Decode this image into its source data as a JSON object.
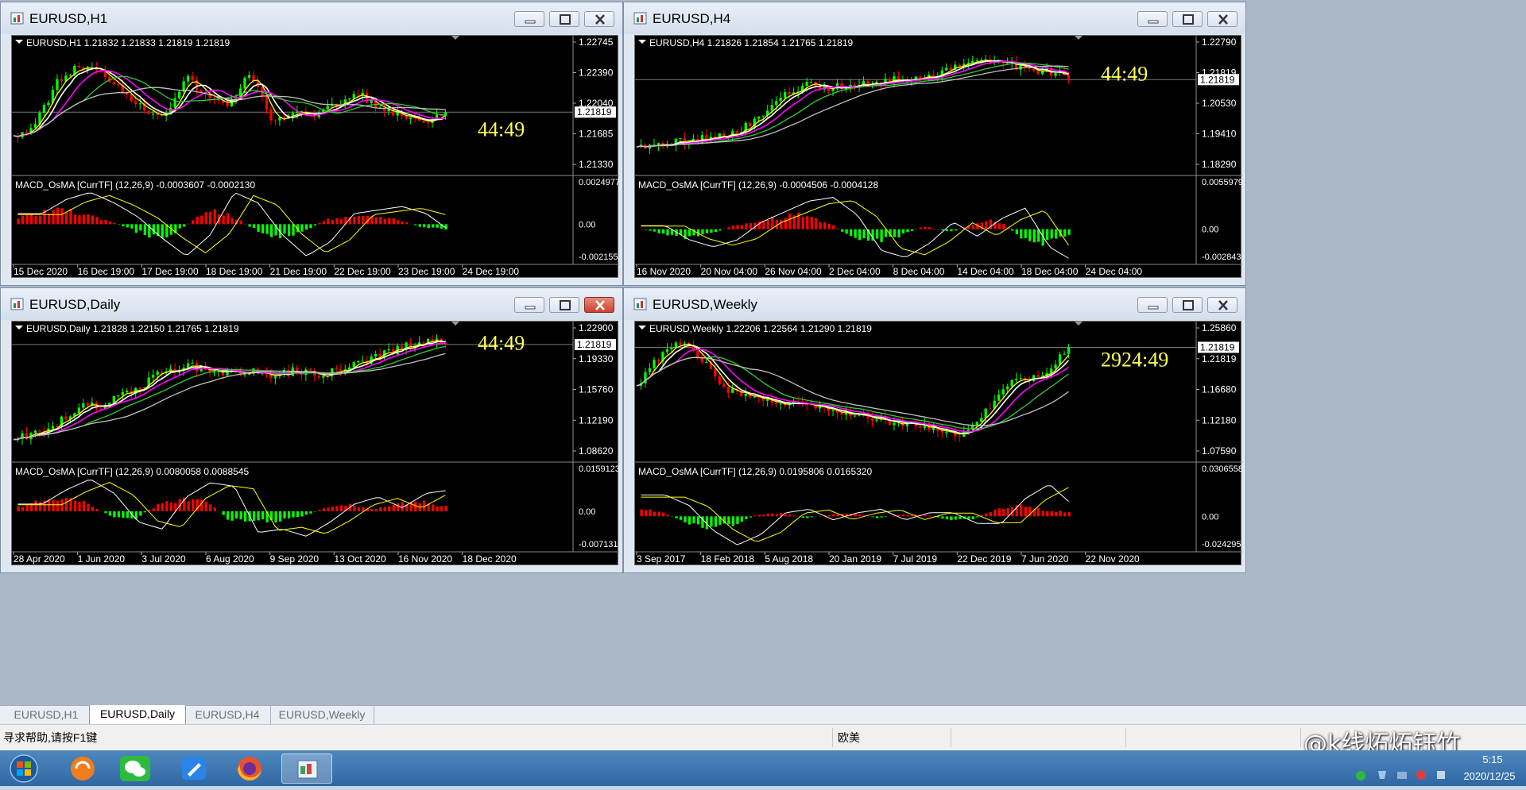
{
  "windows": [
    {
      "id": "h1",
      "title": "EURUSD,H1",
      "close_active": false,
      "info": "EURUSD,H1  1.21832 1.21833 1.21819 1.21819",
      "price_scale": [
        "1.22745",
        "1.22390",
        "1.22040",
        "1.21685",
        "1.21330"
      ],
      "current_price": "1.21819",
      "countdown": "44:49",
      "macd_info": "MACD_OsMA [CurrTF] (12,26,9) -0.0003607 -0.0002130",
      "macd_scale": [
        "0.0024977",
        "0.00",
        "-0.0021552"
      ],
      "dates": [
        "15 Dec 2020",
        "16 Dec 19:00",
        "17 Dec 19:00",
        "18 Dec 19:00",
        "21 Dec 19:00",
        "22 Dec 19:00",
        "23 Dec 19:00",
        "24 Dec 19:00"
      ]
    },
    {
      "id": "h4",
      "title": "EURUSD,H4",
      "close_active": false,
      "info": "EURUSD,H4  1.21826 1.21854 1.21765 1.21819",
      "price_scale": [
        "1.22790",
        "1.21819",
        "1.20530",
        "1.19410",
        "1.18290"
      ],
      "current_price": "1.21819",
      "countdown": "44:49",
      "macd_info": "MACD_OsMA [CurrTF] (12,26,9) -0.0004506 -0.0004128",
      "macd_scale": [
        "0.0055979",
        "0.00",
        "-0.0028437"
      ],
      "dates": [
        "16 Nov 2020",
        "20 Nov 04:00",
        "26 Nov 04:00",
        "2 Dec 04:00",
        "8 Dec 04:00",
        "14 Dec 04:00",
        "18 Dec 04:00",
        "24 Dec 04:00"
      ]
    },
    {
      "id": "daily",
      "title": "EURUSD,Daily",
      "close_active": true,
      "info": "EURUSD,Daily  1.21828 1.22150 1.21765 1.21819",
      "price_scale": [
        "1.22900",
        "1.19330",
        "1.15760",
        "1.12190",
        "1.08620"
      ],
      "current_price": "1.21819",
      "countdown": "44:49",
      "macd_info": "MACD_OsMA [CurrTF] (12,26,9) 0.0080058 0.0088545",
      "macd_scale": [
        "0.0159123",
        "0.00",
        "-0.0071319"
      ],
      "dates": [
        "28 Apr 2020",
        "1 Jun 2020",
        "3 Jul 2020",
        "6 Aug 2020",
        "9 Sep 2020",
        "13 Oct 2020",
        "16 Nov 2020",
        "18 Dec 2020"
      ]
    },
    {
      "id": "weekly",
      "title": "EURUSD,Weekly",
      "close_active": false,
      "info": "EURUSD,Weekly  1.22206 1.22564 1.21290 1.21819",
      "price_scale": [
        "1.25860",
        "1.21819",
        "1.16680",
        "1.12180",
        "1.07590"
      ],
      "current_price": "1.21819",
      "countdown": "2924:49",
      "macd_info": "MACD_OsMA [CurrTF] (12,26,9) 0.0195806 0.0165320",
      "macd_scale": [
        "0.0306558",
        "0.00",
        "-0.024295"
      ],
      "dates": [
        "3 Sep 2017",
        "18 Feb 2018",
        "5 Aug 2018",
        "20 Jan 2019",
        "7 Jul 2019",
        "22 Dec 2019",
        "7 Jun 2020",
        "22 Nov 2020"
      ]
    }
  ],
  "tabs": [
    "EURUSD,H1",
    "EURUSD,Daily",
    "EURUSD,H4",
    "EURUSD,Weekly"
  ],
  "active_tab": 1,
  "status": {
    "help": "寻求帮助,请按F1键",
    "profile": "欧美"
  },
  "watermark": "@k线炻炻钰竹",
  "clock": {
    "time": "5:15",
    "date": "2020/12/25"
  },
  "colors": {
    "bull": "#00ff00",
    "bear": "#ff0000",
    "ma_yellow": "#ffff00",
    "ma_white": "#ffffff",
    "ma_magenta": "#ff00ff",
    "ma_green": "#32cd32",
    "ma_gray": "#c0c0c0",
    "countdown": "#ffff55"
  }
}
